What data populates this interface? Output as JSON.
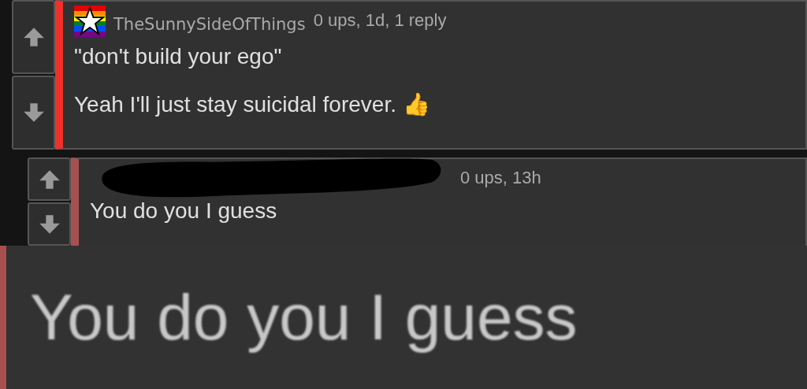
{
  "comments": [
    {
      "username": "TheSunnySideOfThings",
      "username_hidden": false,
      "flag_badge": true,
      "meta": "0 ups, 1d, 1 reply",
      "color": "#f0302a",
      "paragraphs": [
        "\"don't build your ego\"",
        "Yeah I'll just stay suicidal forever. 👍"
      ]
    },
    {
      "username_hidden": true,
      "flag_badge": false,
      "meta": "0 ups, 13h",
      "color": "#a85050",
      "paragraphs": [
        "You do you I guess"
      ]
    }
  ],
  "zoom_panel": {
    "text": "You do you I guess"
  }
}
